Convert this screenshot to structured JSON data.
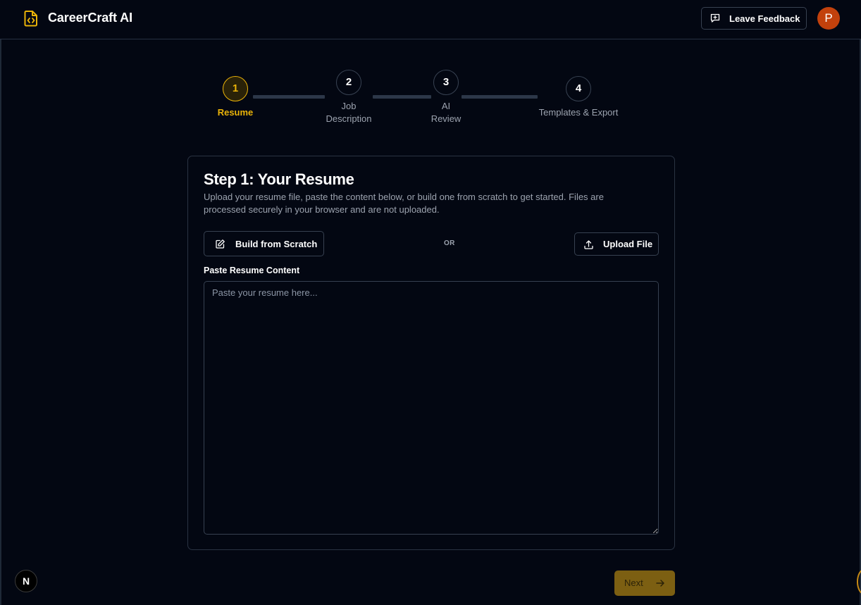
{
  "header": {
    "app_title": "CareerCraft AI",
    "logo_icon": "file-code-icon",
    "feedback_label": "Leave Feedback",
    "feedback_icon": "message-plus-icon",
    "avatar_initial": "P"
  },
  "stepper": {
    "steps": [
      {
        "number": "1",
        "label": "Resume",
        "active": true
      },
      {
        "number": "2",
        "label_line1": "Job",
        "label_line2": "Description",
        "active": false
      },
      {
        "number": "3",
        "label_line1": "AI",
        "label_line2": "Review",
        "active": false
      },
      {
        "number": "4",
        "label": "Templates & Export",
        "active": false
      }
    ]
  },
  "card": {
    "title": "Step 1: Your Resume",
    "description": "Upload your resume file, paste the content below, or build one from scratch to get started. Files are processed securely in your browser and are not uploaded.",
    "build_label": "Build from Scratch",
    "build_icon": "edit-square-icon",
    "or_text": "OR",
    "upload_label": "Upload File",
    "upload_icon": "upload-icon",
    "paste_label": "Paste Resume Content",
    "paste_placeholder": "Paste your resume here...",
    "paste_value": ""
  },
  "footer": {
    "next_label": "Next",
    "next_icon": "arrow-right-icon",
    "badge_text": "N"
  },
  "colors": {
    "background": "#030712",
    "accent": "#eab308",
    "next_button": "#7c5f12",
    "avatar": "#c2410c"
  }
}
